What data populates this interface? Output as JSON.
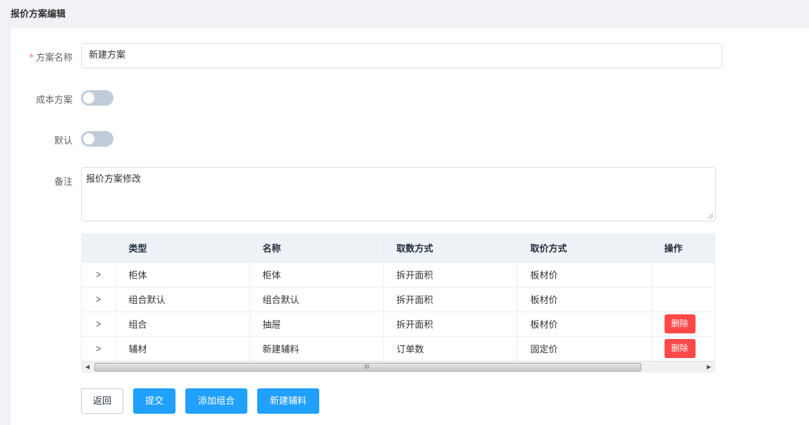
{
  "header": {
    "title": "报价方案编辑"
  },
  "form": {
    "name": {
      "label": "方案名称",
      "required_mark": "*",
      "value": "新建方案"
    },
    "cost_plan": {
      "label": "成本方案",
      "on": false
    },
    "default": {
      "label": "默认",
      "on": false
    },
    "remark": {
      "label": "备注",
      "value": "报价方案修改"
    }
  },
  "table": {
    "columns": [
      "类型",
      "名称",
      "取数方式",
      "取价方式",
      "操作"
    ],
    "rows": [
      {
        "type": "柜体",
        "name": "柜体",
        "fetch_method": "拆开面积",
        "price_method": "板材价",
        "action": ""
      },
      {
        "type": "组合默认",
        "name": "组合默认",
        "fetch_method": "拆开面积",
        "price_method": "板材价",
        "action": ""
      },
      {
        "type": "组合",
        "name": "抽屉",
        "fetch_method": "拆开面积",
        "price_method": "板材价",
        "action": "删除"
      },
      {
        "type": "辅材",
        "name": "新建辅料",
        "fetch_method": "订单数",
        "price_method": "固定价",
        "action": "删除"
      }
    ],
    "scrollbar": {
      "grip": "III"
    }
  },
  "buttons": {
    "back": "返回",
    "submit": "提交",
    "add_group": "添加组合",
    "new_material": "新建辅料"
  },
  "colors": {
    "primary": "#20a0ff",
    "danger": "#ff4949",
    "switch_off": "#c0ccda"
  }
}
